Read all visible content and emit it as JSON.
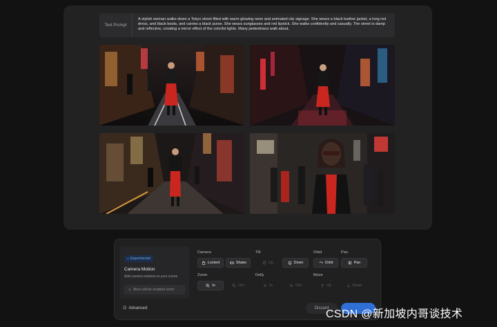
{
  "prompt": {
    "label": "Text Prompt",
    "text": "A stylish woman walks down a Tokyo street filled with warm glowing neon and animated city signage. She wears a black leather jacket, a long red dress, and black boots, and carries a black purse. She wears sunglasses and red lipstick. She walks confidently and casually. The street is damp and reflective, creating a mirror effect of the colorful lights. Many pedestrians walk about."
  },
  "camera_motion": {
    "badge": "Experimental",
    "title": "Camera Motion",
    "subtitle": "Add camera motions to your scene",
    "more": "More will be enabled soon!"
  },
  "groups": {
    "camera": "Camera",
    "tilt": "Tilt",
    "orbit": "Orbit",
    "pan": "Pan",
    "zoom": "Zoom",
    "dolly": "Dolly",
    "move": "Move"
  },
  "buttons": {
    "locked": "Locked",
    "shake": "Shake",
    "tilt_up": "Up",
    "tilt_down": "Down",
    "orbit": "Orbit",
    "pan": "Pan",
    "zoom_in": "In",
    "zoom_out": "Out",
    "dolly_in": "In",
    "dolly_out": "Out",
    "move_up": "Up",
    "move_down": "Down"
  },
  "footer": {
    "advanced": "Advanced",
    "discard": "Discard"
  },
  "watermark": "CSDN @新加坡内哥谈技术",
  "colors": {
    "accent": "#2f6fd6",
    "badge_text": "#6aa5ee",
    "dress_red": "#c8261e"
  }
}
